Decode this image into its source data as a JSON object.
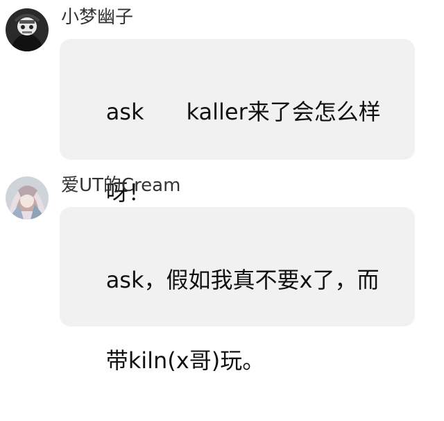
{
  "messages": [
    {
      "username": "小梦幽子",
      "avatar_icon": "skeleton-avatar-icon",
      "text_lines": [
        "ask      kaller来了会怎么样",
        "呀！"
      ]
    },
    {
      "username": "爱UT的Cream",
      "avatar_icon": "anime-character-avatar-icon",
      "text_lines": [
        "ask，假如我真不要x了，而",
        "带kiln(x哥)玩。"
      ]
    }
  ],
  "colors": {
    "bubble_background": "#f1f1f1",
    "username_text": "#333333",
    "message_text": "#111111"
  }
}
